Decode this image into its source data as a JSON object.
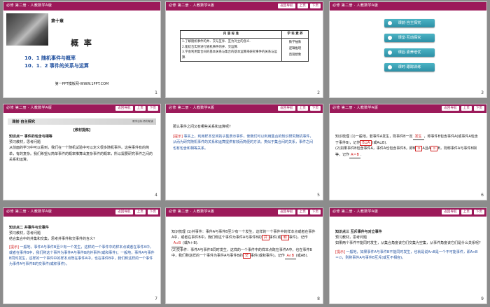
{
  "header": {
    "course": "必修 第二册 · 人教数学A版",
    "nav_back": "返回导航",
    "nav_prev": "上页",
    "nav_next": "下页"
  },
  "slide1": {
    "chapter": "第十章",
    "title": "概 率",
    "line1": "10．1   随机事件与概率",
    "line2": "10．1．2   事件的关系与运算",
    "footer": "第一PPT模板网-WWW.1PPT.COM",
    "page": "1"
  },
  "slide2": {
    "col1": "内 容 标 准",
    "col2": "学 科 素 养",
    "items": [
      "1.了解随机事件的并、交与互斥、互为对立的含义.",
      "2.能结合实例进行随机事件的并、交运算.",
      "3.学会利用集合间的基本关系与集合的基本运算来研究事件的关系与运算."
    ],
    "skills": [
      "数学抽象",
      "逻辑推理",
      "直观想象"
    ],
    "page": "2"
  },
  "slide3": {
    "menu": [
      "课前·自主探究",
      "课堂·互动探究",
      "课后·素养培优",
      "课时·跟踪训练"
    ],
    "page": "3"
  },
  "slide4": {
    "section": "课前·自主探究",
    "section_right": "教学目标  教材助读",
    "tag": "[教材提炼]",
    "point_title": "知识点一   事件的包含与相等",
    "read": "预习教材，思考问题",
    "body": "从前面的学习中可以看到，我们在一个随机试验中可以定义很多随机事件。这些事件有的简单，有的复杂。我们希望从简单事件的概率推算出复杂事件的概率，所以需要研究事件之间的关系和运算。",
    "page": "4"
  },
  "slide5": {
    "question": "那么事件之间又有哪些关系和运算呢?",
    "answer_tag": "[提示]",
    "answer": "事实上，利用样本空间的子集表示事件，使我们可以利用集合的知识研究随机事件，从而为研究随机事件的关系和运算提供有效而简便的方法。类似于集合间的关系，事件之间也有包含和相等关系。",
    "page": "5"
  },
  "slide6": {
    "intro": "知识梳理",
    "s1": "(1)一般地，若事件A发生，则事件B一定",
    "s1_ans": "发生",
    "s1b": "，称事件B包含事件A(或事件A包含于事件B)，记作",
    "s1_ans2": "B⊇A",
    "s1c": "(或A⊆B).",
    "s2": "(2)如果事件B包含事件A，事件A也包含事件B，即B",
    "s2_ans": "⊇",
    "s2b": "A且A",
    "s2_ans2": "⊇",
    "s2c": "B，则称事件A与事件B相等，记作",
    "s2_ans3": "A＝B",
    "s2d": ".",
    "page": "6"
  },
  "slide7": {
    "point_title": "知识点二   并事件与交事件",
    "read": "预习教材，思考问题",
    "question": "结合集合中的并集和交集，思考并事件和交事件的含义?",
    "answer_tag": "[提示]",
    "answer": "一般地，事件A与事件B至少有一个发生，这样的一个事件中的样本点或者在事件A中，或者在事件B中，我们称这个事件为事件A与事件B的并事件(或和事件)；一般地，事件A与事件B同时发生，这样的一个事件中的样本点既在事件A中，也在事件B中，我们称这样的一个事件为事件A与事件B的交事件(或积事件)。",
    "page": "7"
  },
  "slide8": {
    "intro": "知识梳理",
    "p1": "(1)并事件：事件A与事件B至少有一个发生，这样的一个事件中的样本点或者在事件A中，或者在事件B中，我们称这个事件为事件A与事件B的",
    "p1_ans": "并",
    "p1b": "事件(或",
    "p1_ans2": "和",
    "p1c": "事件)，记作",
    "p1_ans3": "A∪B",
    "p1d": "(或A＋B).",
    "p2": "(2)交事件：事件A与事件B同时发生，这样的一个事件中的样本点既在事件A中，也在事件B中，我们称这样的一个事件为事件A与事件B的",
    "p2_ans": "交",
    "p2b": "事件(或积事件)，记作",
    "p2_ans2": "A∩B",
    "p2c": "(或AB).",
    "page": "8"
  },
  "slide9": {
    "point_title": "知识点三   互斥事件与对立事件",
    "read": "预习教材，思考问题",
    "question": "如果两个事件不能同时发生，从集合角度该它们交集为空集，从事件角度该它们是什么关系呢?",
    "answer_tag": "[提示]",
    "answer": "一般地，如果事件A与事件B不能同时发生，也就是说A∩B是一个不可能事件，即A∩B＝∅，则称事件A与事件B互斥(或互不相容)。",
    "page": "9"
  }
}
